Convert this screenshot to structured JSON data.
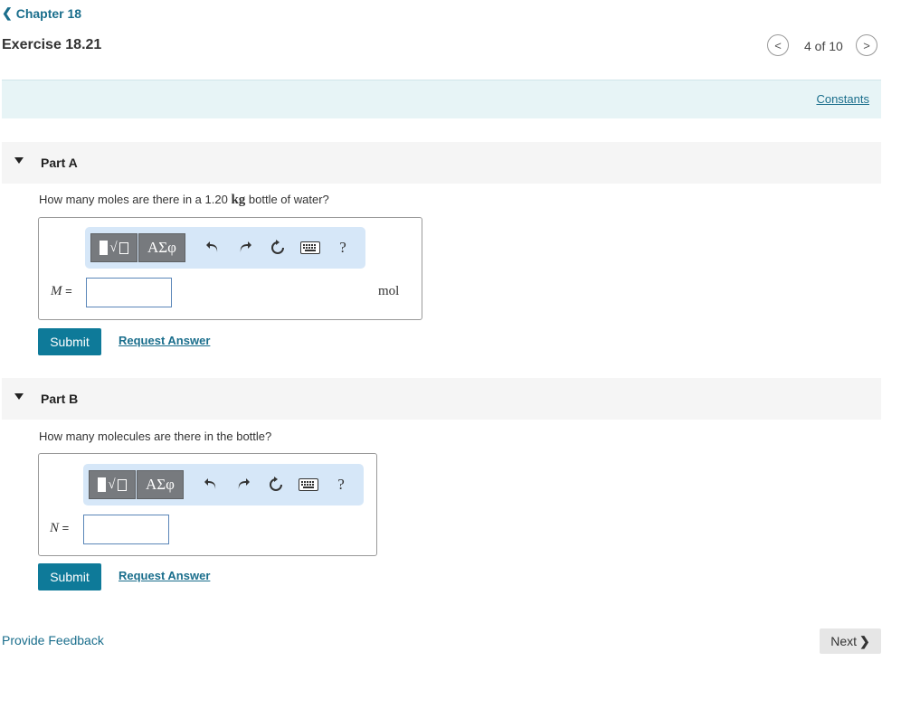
{
  "nav": {
    "back_label": "Chapter 18",
    "exercise_title": "Exercise 18.21",
    "page_counter": "4 of 10",
    "constants_link": "Constants"
  },
  "parts": [
    {
      "label": "Part A",
      "question_pre": "How many moles are there in a 1.20 ",
      "question_unit": "kg",
      "question_post": " bottle of water?",
      "variable": "M",
      "equals": " =",
      "input_value": "",
      "answer_unit": "mol",
      "submit_label": "Submit",
      "request_label": "Request Answer"
    },
    {
      "label": "Part B",
      "question": "How many molecules are there in the bottle?",
      "variable": "N",
      "equals": " =",
      "input_value": "",
      "answer_unit": "",
      "submit_label": "Submit",
      "request_label": "Request Answer"
    }
  ],
  "toolbar": {
    "greek_label": "ΑΣφ",
    "help_label": "?",
    "icons": [
      "templates-icon",
      "greek-letters-icon",
      "undo-icon",
      "redo-icon",
      "reset-icon",
      "keyboard-icon",
      "help-icon"
    ]
  },
  "footer": {
    "feedback_label": "Provide Feedback",
    "next_label": "Next"
  },
  "colors": {
    "accent": "#0e7a99",
    "link": "#1a6e8c",
    "constants_bg": "#e7f4f6",
    "toolbar_bg": "#d6e7f8"
  }
}
